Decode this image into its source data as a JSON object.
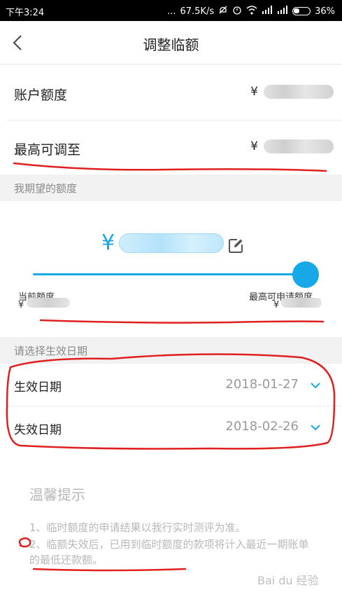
{
  "status_bar": {
    "time": "下午3:24",
    "dots": "...",
    "speed": "67.5K/s",
    "battery": "36%"
  },
  "header": {
    "title": "调整临额"
  },
  "account": {
    "label": "账户额度",
    "currency": "¥"
  },
  "max": {
    "label": "最高可调至",
    "currency": "¥"
  },
  "expected": {
    "section_title": "我期望的额度",
    "currency": "¥",
    "slider_value": 1.0
  },
  "slider": {
    "left_label": "当前额度",
    "left_currency": "¥",
    "right_label": "最高可申请额度",
    "right_currency": "¥"
  },
  "dates": {
    "section_title": "请选择生效日期",
    "effective_label": "生效日期",
    "effective_value": "2018-01-27",
    "expire_label": "失效日期",
    "expire_value": "2018-02-26"
  },
  "tips": {
    "title": "温馨提示",
    "items": [
      "1、临时额度的申请结果以我行实时测评为准。",
      "2、临额失效后，已用到临时额度的款项将计入最近一期账单的最低还款额。"
    ]
  },
  "colors": {
    "accent": "#17a8e7",
    "annotation": "#e02020"
  }
}
